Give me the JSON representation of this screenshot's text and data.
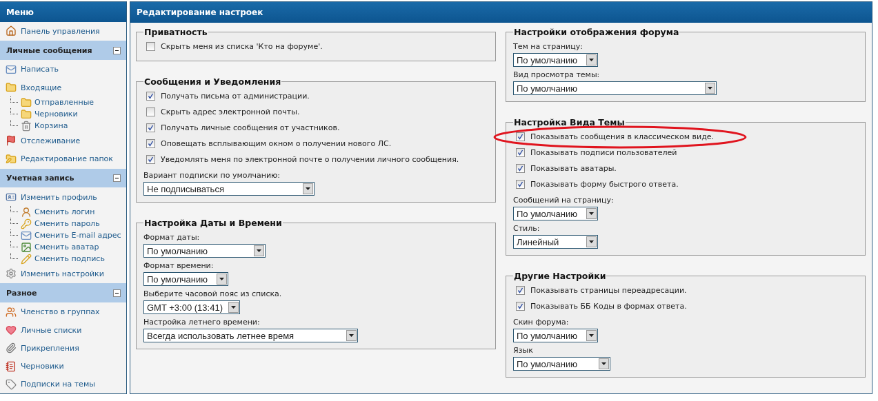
{
  "menu": {
    "title": "Меню",
    "items": [
      {
        "kind": "link",
        "label": "Панель управления"
      },
      {
        "kind": "section",
        "label": "Личные сообщения",
        "expanded": true
      },
      {
        "kind": "link",
        "label": "Написать"
      },
      {
        "kind": "link",
        "label": "Входящие",
        "children": [
          {
            "label": "Отправленные"
          },
          {
            "label": "Черновики"
          },
          {
            "label": "Корзина"
          }
        ]
      },
      {
        "kind": "link",
        "label": "Отслеживание"
      },
      {
        "kind": "link",
        "label": "Редактирование папок"
      },
      {
        "kind": "section",
        "label": "Учетная запись",
        "expanded": true
      },
      {
        "kind": "link",
        "label": "Изменить профиль",
        "children": [
          {
            "label": "Сменить логин"
          },
          {
            "label": "Сменить пароль"
          },
          {
            "label": "Сменить E-mail адрес"
          },
          {
            "label": "Сменить аватар"
          },
          {
            "label": "Сменить подпись"
          }
        ]
      },
      {
        "kind": "link",
        "label": "Изменить настройки"
      },
      {
        "kind": "section",
        "label": "Разное",
        "expanded": true
      },
      {
        "kind": "link",
        "label": "Членство в группах"
      },
      {
        "kind": "link",
        "label": "Личные списки"
      },
      {
        "kind": "link",
        "label": "Прикрепления"
      },
      {
        "kind": "link",
        "label": "Черновики"
      },
      {
        "kind": "link",
        "label": "Подписки на темы"
      }
    ]
  },
  "panel": {
    "title": "Редактирование настроек",
    "columns": [
      [
        {
          "legend": "Приватность",
          "fields": [
            {
              "kind": "checkbox",
              "label": "Скрыть меня из списка 'Кто на форуме'.",
              "checked": false
            }
          ]
        },
        {
          "legend": "Сообщения и Уведомления",
          "fields": [
            {
              "kind": "checkbox",
              "label": "Получать письма от администрации.",
              "checked": true
            },
            {
              "kind": "checkbox",
              "label": "Скрыть адрес электронной почты.",
              "checked": false
            },
            {
              "kind": "checkbox",
              "label": "Получать личные сообщения от участников.",
              "checked": true
            },
            {
              "kind": "checkbox",
              "label": "Оповещать всплывающим окном о получении нового ЛС.",
              "checked": true
            },
            {
              "kind": "checkbox",
              "label": "Уведомлять меня по электронной почте о получении личного сообщения.",
              "checked": true
            },
            {
              "kind": "select",
              "label": "Вариант подписки по умолчанию:",
              "value": "Не подписываться"
            }
          ]
        },
        {
          "legend": "Настройка Даты и Времени",
          "fields": [
            {
              "kind": "select",
              "label": "Формат даты:",
              "value": "По умолчанию"
            },
            {
              "kind": "select",
              "label": "Формат времени:",
              "value": "По умолчанию"
            },
            {
              "kind": "select",
              "label": "Выберите часовой пояс из списка.",
              "value": "GMT +3:00 (13:41)"
            },
            {
              "kind": "select",
              "label": "Настройка летнего времени:",
              "value": "Всегда использовать летнее время"
            }
          ]
        }
      ],
      [
        {
          "legend": "Настройки отображения форума",
          "fields": [
            {
              "kind": "select",
              "label": "Тем на страницу:",
              "value": "По умолчанию"
            },
            {
              "kind": "select",
              "label": "Вид просмотра темы:",
              "value": "По умолчанию"
            }
          ]
        },
        {
          "legend": "Настройка Вида Темы",
          "fields": [
            {
              "kind": "checkbox",
              "label": "Показывать сообщения в классическом виде.",
              "checked": true,
              "circled": true
            },
            {
              "kind": "checkbox",
              "label": "Показывать подписи пользователей",
              "checked": true
            },
            {
              "kind": "checkbox",
              "label": "Показывать аватары.",
              "checked": true
            },
            {
              "kind": "checkbox",
              "label": "Показывать форму быстрого ответа.",
              "checked": true
            },
            {
              "kind": "select",
              "label": "Сообщений на страницу:",
              "value": "По умолчанию"
            },
            {
              "kind": "select",
              "label": "Стиль:",
              "value": "Линейный"
            }
          ]
        },
        {
          "legend": "Другие Настройки",
          "fields": [
            {
              "kind": "checkbox",
              "label": "Показывать страницы переадресации.",
              "checked": true
            },
            {
              "kind": "checkbox",
              "label": "Показывать ББ Коды в формах ответа.",
              "checked": true
            },
            {
              "kind": "select",
              "label": "Скин форума:",
              "value": "По умолчанию"
            },
            {
              "kind": "select",
              "label": "Язык",
              "value": "По умолчанию"
            }
          ]
        }
      ]
    ]
  }
}
